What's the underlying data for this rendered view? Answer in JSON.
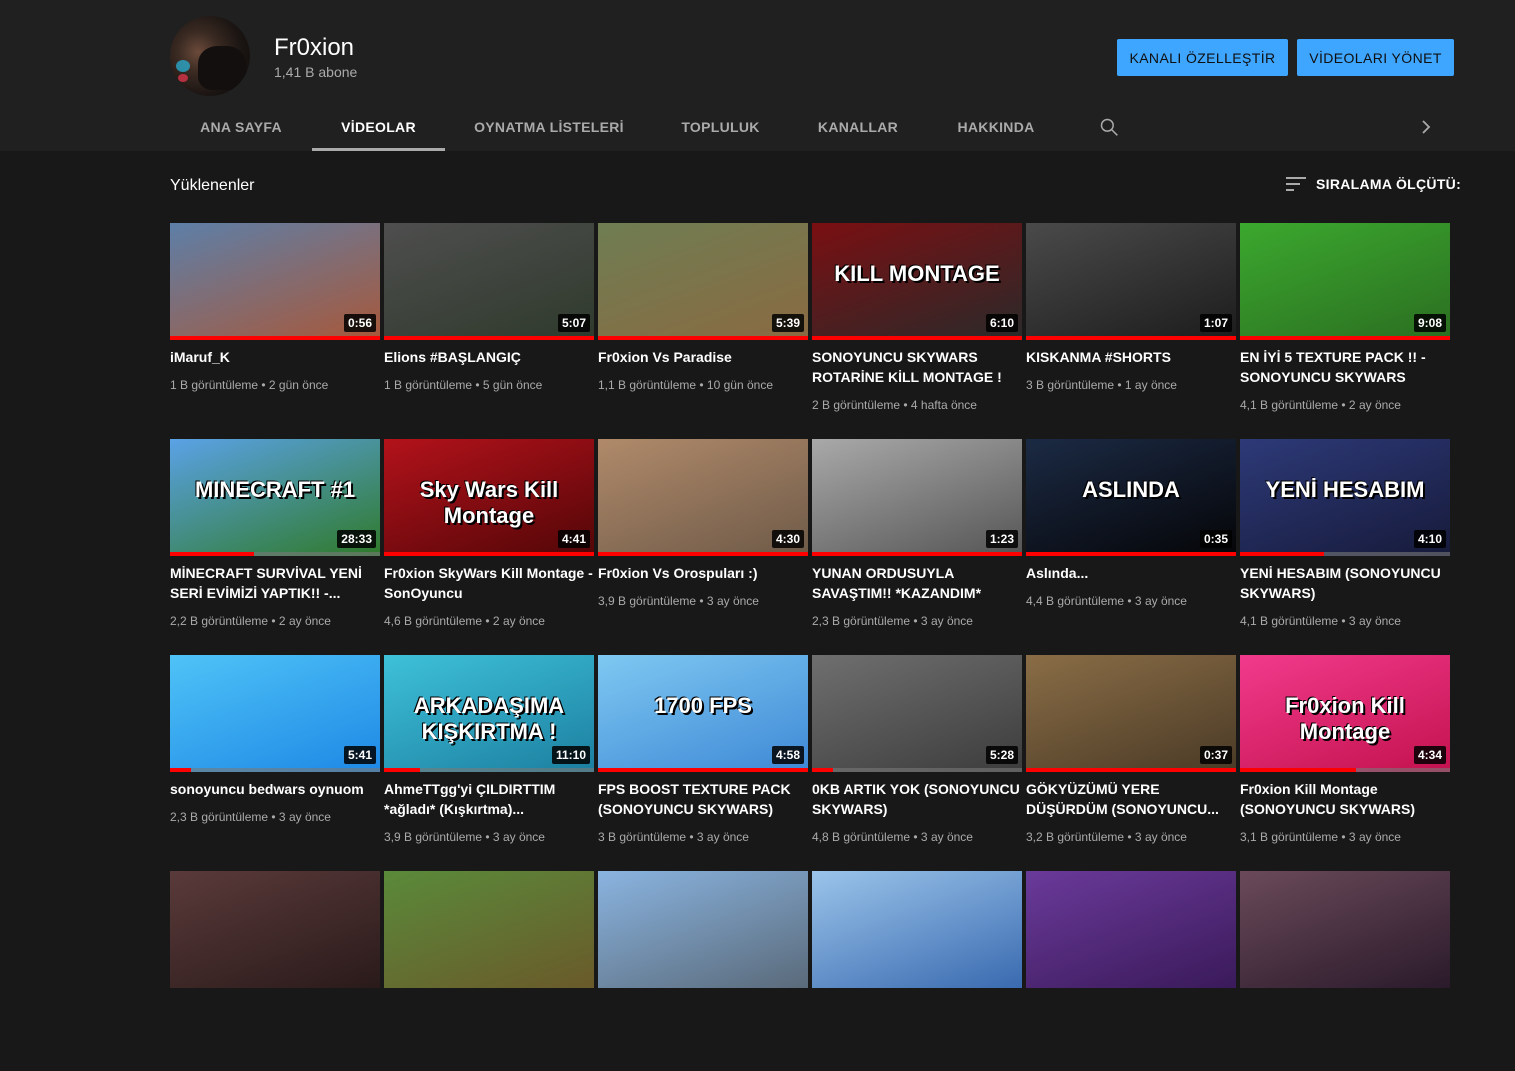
{
  "channel": {
    "name": "Fr0xion",
    "subscribers": "1,41 B abone",
    "customize_label": "KANALI ÖZELLEŞTİR",
    "manage_label": "VİDEOLARI YÖNET"
  },
  "tabs": [
    {
      "label": "ANA SAYFA",
      "active": false
    },
    {
      "label": "VİDEOLAR",
      "active": true
    },
    {
      "label": "OYNATMA LİSTELERİ",
      "active": false
    },
    {
      "label": "TOPLULUK",
      "active": false
    },
    {
      "label": "KANALLAR",
      "active": false
    },
    {
      "label": "HAKKINDA",
      "active": false
    }
  ],
  "icons": {
    "search": "search-icon",
    "next": "chevron-right-icon",
    "sort": "sort-icon"
  },
  "section": {
    "title": "Yüklenenler",
    "sort_label": "SIRALAMA ÖLÇÜTÜ:"
  },
  "colors": {
    "accent": "#3ea6ff",
    "progress": "#ff0000",
    "background": "#181818",
    "header": "#202020"
  },
  "videos": [
    {
      "title": "iMaruf_K",
      "meta": "1 B görüntüleme • 2 gün önce",
      "duration": "0:56",
      "watched": 1.0,
      "bg": [
        "#5d7fa8",
        "#a8583a"
      ],
      "label": ""
    },
    {
      "title": "Elions #BAŞLANGIÇ",
      "meta": "1 B görüntüleme • 5 gün önce",
      "duration": "5:07",
      "watched": 1.0,
      "bg": [
        "#4e4e4e",
        "#2f3a2c"
      ],
      "label": ""
    },
    {
      "title": "Fr0xion Vs Paradise",
      "meta": "1,1 B görüntüleme • 10 gün önce",
      "duration": "5:39",
      "watched": 1.0,
      "bg": [
        "#6f7d52",
        "#8a6a42"
      ],
      "label": ""
    },
    {
      "title": "SONOYUNCU SKYWARS ROTARİNE KİLL MONTAGE !",
      "meta": "2 B görüntüleme • 4 hafta önce",
      "duration": "6:10",
      "watched": 1.0,
      "bg": [
        "#7a0f12",
        "#2a2a2a"
      ],
      "label": "KILL MONTAGE"
    },
    {
      "title": "KISKANMA #SHORTS",
      "meta": "3 B görüntüleme • 1 ay önce",
      "duration": "1:07",
      "watched": 1.0,
      "bg": [
        "#4a4a4a",
        "#1c1c1c"
      ],
      "label": ""
    },
    {
      "title": "EN İYİ 5 TEXTURE PACK !! - SONOYUNCU SKYWARS",
      "meta": "4,1 B görüntüleme • 2 ay önce",
      "duration": "9:08",
      "watched": 1.0,
      "bg": [
        "#3ba82e",
        "#2b6e21"
      ],
      "label": ""
    },
    {
      "title": "MİNECRAFT SURVİVAL YENİ SERİ EVİMİZİ YAPTIK!! -...",
      "meta": "2,2 B görüntüleme • 2 ay önce",
      "duration": "28:33",
      "watched": 0.4,
      "bg": [
        "#5aa2e6",
        "#2f7a2a"
      ],
      "label": "MINECRAFT #1"
    },
    {
      "title": "Fr0xion SkyWars Kill Montage - SonOyuncu",
      "meta": "4,6 B görüntüleme • 2 ay önce",
      "duration": "4:41",
      "watched": 1.0,
      "bg": [
        "#b3121a",
        "#520608"
      ],
      "label": "Sky Wars Kill Montage"
    },
    {
      "title": "Fr0xion Vs Orospuları :)",
      "meta": "3,9 B görüntüleme • 3 ay önce",
      "duration": "4:30",
      "watched": 1.0,
      "bg": [
        "#b08a6a",
        "#6e5a48"
      ],
      "label": ""
    },
    {
      "title": "YUNAN ORDUSUYLA SAVAŞTIM!! *KAZANDIM*",
      "meta": "2,3 B görüntüleme • 3 ay önce",
      "duration": "1:23",
      "watched": 1.0,
      "bg": [
        "#a9a9a9",
        "#555555"
      ],
      "label": ""
    },
    {
      "title": "Aslında...",
      "meta": "4,4 B görüntüleme • 3 ay önce",
      "duration": "0:35",
      "watched": 1.0,
      "bg": [
        "#1b2a44",
        "#050507"
      ],
      "label": "ASLINDA"
    },
    {
      "title": "YENİ HESABIM (SONOYUNCU SKYWARS)",
      "meta": "4,1 B görüntüleme • 3 ay önce",
      "duration": "4:10",
      "watched": 0.4,
      "bg": [
        "#2d3a78",
        "#161a3a"
      ],
      "label": "YENİ HESABIM"
    },
    {
      "title": "sonoyuncu bedwars oynuom",
      "meta": "2,3 B görüntüleme • 3 ay önce",
      "duration": "5:41",
      "watched": 0.1,
      "bg": [
        "#4fc3f7",
        "#1e88e5"
      ],
      "label": ""
    },
    {
      "title": "AhmeTTgg'yi ÇILDIRTTIM *ağladı* (Kışkırtma)...",
      "meta": "3,9 B görüntüleme • 3 ay önce",
      "duration": "11:10",
      "watched": 0.17,
      "bg": [
        "#3ec1d9",
        "#1c7fa0"
      ],
      "label": "ARKADAŞIMA KIŞKIRTMA !"
    },
    {
      "title": "FPS BOOST TEXTURE PACK (SONOYUNCU SKYWARS)",
      "meta": "3 B görüntüleme • 3 ay önce",
      "duration": "4:58",
      "watched": 1.0,
      "bg": [
        "#7ec8f2",
        "#3e88d6"
      ],
      "label": "1700 FPS"
    },
    {
      "title": "0KB ARTIK YOK (SONOYUNCU SKYWARS)",
      "meta": "4,8 B görüntüleme • 3 ay önce",
      "duration": "5:28",
      "watched": 0.1,
      "bg": [
        "#6f6f6f",
        "#3c3c3c"
      ],
      "label": ""
    },
    {
      "title": "GÖKYÜZÜMÜ YERE DÜŞÜRDÜM (SONOYUNCU...",
      "meta": "3,2 B görüntüleme • 3 ay önce",
      "duration": "0:37",
      "watched": 1.0,
      "bg": [
        "#8a6d46",
        "#4a3a26"
      ],
      "label": ""
    },
    {
      "title": "Fr0xion Kill Montage (SONOYUNCU SKYWARS)",
      "meta": "3,1 B görüntüleme • 3 ay önce",
      "duration": "4:34",
      "watched": 0.55,
      "bg": [
        "#f23a8c",
        "#c3124e"
      ],
      "label": "Fr0xion Kill Montage"
    },
    {
      "title": "",
      "meta": "",
      "duration": "",
      "watched": 0,
      "bg": [
        "#5a3a3a",
        "#2a1a1a"
      ],
      "label": ""
    },
    {
      "title": "",
      "meta": "",
      "duration": "",
      "watched": 0,
      "bg": [
        "#5a8a3a",
        "#6a5a2a"
      ],
      "label": ""
    },
    {
      "title": "",
      "meta": "",
      "duration": "",
      "watched": 0,
      "bg": [
        "#8ab4e0",
        "#5a6a7a"
      ],
      "label": ""
    },
    {
      "title": "",
      "meta": "",
      "duration": "",
      "watched": 0,
      "bg": [
        "#9ac4ea",
        "#3a6ab0"
      ],
      "label": ""
    },
    {
      "title": "",
      "meta": "",
      "duration": "",
      "watched": 0,
      "bg": [
        "#6a3a9a",
        "#3a1a5a"
      ],
      "label": ""
    },
    {
      "title": "",
      "meta": "",
      "duration": "",
      "watched": 0,
      "bg": [
        "#6a4a5a",
        "#2a1a2a"
      ],
      "label": ""
    }
  ]
}
